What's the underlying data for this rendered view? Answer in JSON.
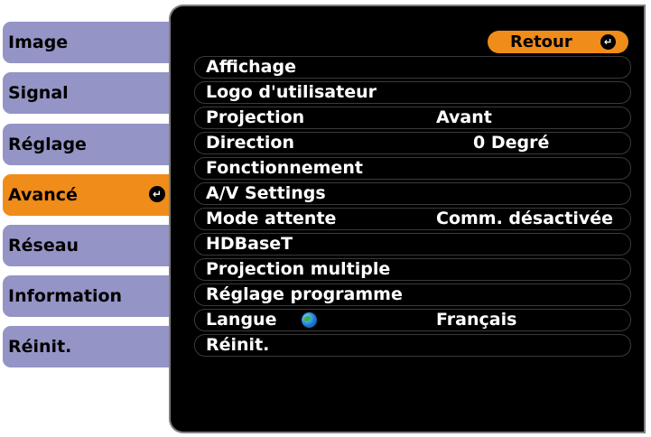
{
  "tabs": [
    {
      "label": "Image",
      "active": false
    },
    {
      "label": "Signal",
      "active": false
    },
    {
      "label": "Réglage",
      "active": false
    },
    {
      "label": "Avancé",
      "active": true
    },
    {
      "label": "Réseau",
      "active": false
    },
    {
      "label": "Information",
      "active": false
    },
    {
      "label": "Réinit.",
      "active": false
    }
  ],
  "return_button": {
    "label": "Retour",
    "icon": "enter-icon"
  },
  "menu": [
    {
      "label": "Affichage",
      "value": ""
    },
    {
      "label": "Logo d'utilisateur",
      "value": ""
    },
    {
      "label": "Projection",
      "value": "Avant"
    },
    {
      "label": "Direction",
      "value": "0 Degré"
    },
    {
      "label": "Fonctionnement",
      "value": ""
    },
    {
      "label": "A/V Settings",
      "value": ""
    },
    {
      "label": "Mode attente",
      "value": "Comm. désactivée"
    },
    {
      "label": "HDBaseT",
      "value": ""
    },
    {
      "label": "Projection multiple",
      "value": ""
    },
    {
      "label": "Réglage programme",
      "value": ""
    },
    {
      "label": "Langue",
      "value": "Français",
      "icon": "globe-icon"
    },
    {
      "label": "Réinit.",
      "value": ""
    }
  ],
  "colors": {
    "accent": "#f08c1a",
    "tab": "#9494c6",
    "panel": "#000000",
    "panel_border": "#7e7e7e"
  }
}
